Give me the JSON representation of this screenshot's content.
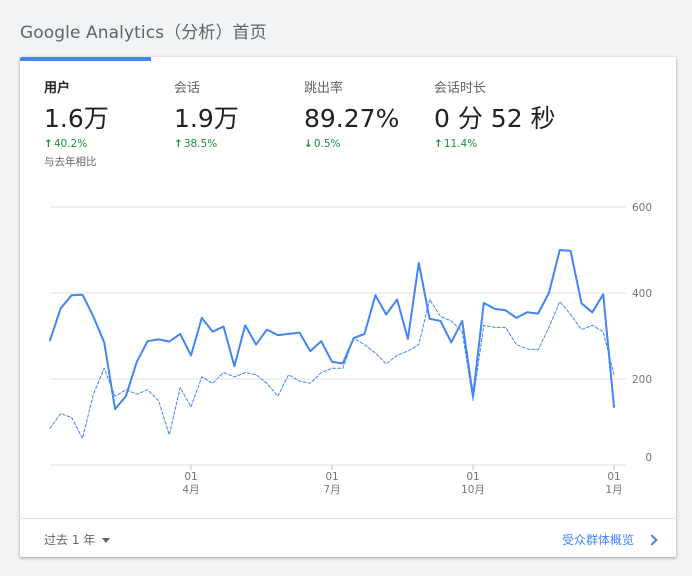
{
  "header": {
    "title": "Google Analytics",
    "subtitle": "（分析）首页"
  },
  "metrics": [
    {
      "label": "用户",
      "value": "1.6万",
      "change": "40.2%",
      "direction": "up",
      "compare": "与去年相比"
    },
    {
      "label": "会话",
      "value": "1.9万",
      "change": "38.5%",
      "direction": "up"
    },
    {
      "label": "跳出率",
      "value": "89.27%",
      "change": "0.5%",
      "direction": "down"
    },
    {
      "label": "会话时长",
      "value": "0 分 52 秒",
      "change": "11.4%",
      "direction": "up"
    }
  ],
  "colors": {
    "accent": "#4285f4",
    "positive": "#1e8e3e",
    "gridline": "#e0e0e0",
    "axis_text": "#757575"
  },
  "footer": {
    "range_label": "过去 1 年",
    "link_label": "受众群体概览"
  },
  "chart_data": {
    "type": "line",
    "ylim": [
      0,
      600
    ],
    "y_ticks": [
      "600",
      "400",
      "200",
      "0"
    ],
    "y_tick_values": [
      600,
      400,
      200,
      0
    ],
    "x_ticks": [
      {
        "day": "01",
        "month": "4月",
        "index": 13
      },
      {
        "day": "01",
        "month": "7月",
        "index": 26
      },
      {
        "day": "01",
        "month": "10月",
        "index": 39
      },
      {
        "day": "01",
        "month": "1月",
        "index": 52
      }
    ],
    "grid": true,
    "series": [
      {
        "style": "solid",
        "values": [
          290,
          365,
          395,
          396,
          345,
          285,
          130,
          160,
          240,
          288,
          292,
          287,
          305,
          255,
          342,
          310,
          322,
          230,
          325,
          280,
          315,
          302,
          305,
          308,
          265,
          288,
          240,
          236,
          295,
          305,
          395,
          350,
          385,
          293,
          470,
          340,
          335,
          285,
          335,
          160,
          377,
          363,
          360,
          342,
          355,
          352,
          400,
          500,
          498,
          376,
          355,
          397,
          135
        ]
      },
      {
        "style": "dashed",
        "values": [
          85,
          120,
          110,
          62,
          165,
          225,
          160,
          175,
          165,
          175,
          150,
          70,
          180,
          135,
          205,
          190,
          215,
          205,
          215,
          210,
          190,
          160,
          210,
          195,
          190,
          215,
          225,
          225,
          295,
          280,
          260,
          235,
          255,
          265,
          280,
          385,
          345,
          335,
          310,
          150,
          325,
          320,
          320,
          280,
          270,
          268,
          320,
          380,
          350,
          315,
          325,
          310,
          210
        ]
      }
    ]
  }
}
